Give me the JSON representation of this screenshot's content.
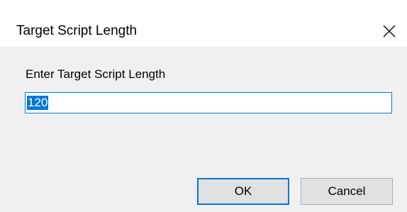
{
  "window": {
    "title": "Target Script Length",
    "close_icon": "close-icon"
  },
  "prompt": {
    "label": "Enter Target Script Length"
  },
  "input": {
    "value": "120",
    "selected": true
  },
  "buttons": {
    "ok_label": "OK",
    "cancel_label": "Cancel"
  },
  "colors": {
    "accent": "#0078d7",
    "client_background": "#f0f0f0",
    "button_face": "#e1e1e1"
  }
}
